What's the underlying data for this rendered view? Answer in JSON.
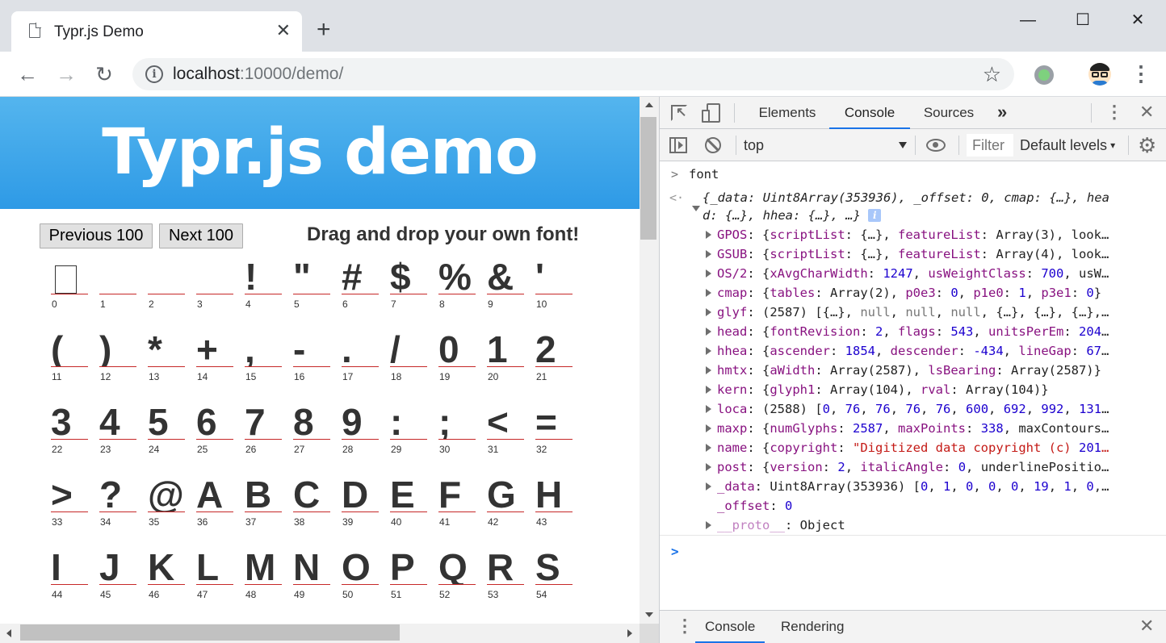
{
  "browser": {
    "tab_title": "Typr.js Demo",
    "tab_close": "✕",
    "new_tab": "+",
    "window_controls": {
      "minimize": "—",
      "maximize": "☐",
      "close": "✕"
    },
    "nav": {
      "back": "←",
      "forward": "→",
      "reload": "↻"
    },
    "url_host": "localhost",
    "url_path": ":10000/demo/",
    "info_symbol": "i",
    "bookmark": "☆",
    "menu": "⋮"
  },
  "page": {
    "title": "Typr.js demo",
    "prev_button": "Previous 100",
    "next_button": "Next 100",
    "drop_hint": "Drag and drop your own font!",
    "glyph_rule_color": "#c62828",
    "banner_color": "#3aa4ea",
    "glyphs": [
      {
        "char": "",
        "index": "0"
      },
      {
        "char": "",
        "index": "1"
      },
      {
        "char": "",
        "index": "2"
      },
      {
        "char": "",
        "index": "3"
      },
      {
        "char": "!",
        "index": "4"
      },
      {
        "char": "\"",
        "index": "5"
      },
      {
        "char": "#",
        "index": "6"
      },
      {
        "char": "$",
        "index": "7"
      },
      {
        "char": "%",
        "index": "8"
      },
      {
        "char": "&",
        "index": "9"
      },
      {
        "char": "'",
        "index": "10"
      },
      {
        "char": "(",
        "index": "11"
      },
      {
        "char": ")",
        "index": "12"
      },
      {
        "char": "*",
        "index": "13"
      },
      {
        "char": "+",
        "index": "14"
      },
      {
        "char": ",",
        "index": "15"
      },
      {
        "char": "-",
        "index": "16"
      },
      {
        "char": ".",
        "index": "17"
      },
      {
        "char": "/",
        "index": "18"
      },
      {
        "char": "0",
        "index": "19"
      },
      {
        "char": "1",
        "index": "20"
      },
      {
        "char": "2",
        "index": "21"
      },
      {
        "char": "3",
        "index": "22"
      },
      {
        "char": "4",
        "index": "23"
      },
      {
        "char": "5",
        "index": "24"
      },
      {
        "char": "6",
        "index": "25"
      },
      {
        "char": "7",
        "index": "26"
      },
      {
        "char": "8",
        "index": "27"
      },
      {
        "char": "9",
        "index": "28"
      },
      {
        "char": ":",
        "index": "29"
      },
      {
        "char": ";",
        "index": "30"
      },
      {
        "char": "<",
        "index": "31"
      },
      {
        "char": "=",
        "index": "32"
      },
      {
        "char": ">",
        "index": "33"
      },
      {
        "char": "?",
        "index": "34"
      },
      {
        "char": "@",
        "index": "35"
      },
      {
        "char": "A",
        "index": "36"
      },
      {
        "char": "B",
        "index": "37"
      },
      {
        "char": "C",
        "index": "38"
      },
      {
        "char": "D",
        "index": "39"
      },
      {
        "char": "E",
        "index": "40"
      },
      {
        "char": "F",
        "index": "41"
      },
      {
        "char": "G",
        "index": "42"
      },
      {
        "char": "H",
        "index": "43"
      },
      {
        "char": "I",
        "index": "44"
      },
      {
        "char": "J",
        "index": "45"
      },
      {
        "char": "K",
        "index": "46"
      },
      {
        "char": "L",
        "index": "47"
      },
      {
        "char": "M",
        "index": "48"
      },
      {
        "char": "N",
        "index": "49"
      },
      {
        "char": "O",
        "index": "50"
      },
      {
        "char": "P",
        "index": "51"
      },
      {
        "char": "Q",
        "index": "52"
      },
      {
        "char": "R",
        "index": "53"
      },
      {
        "char": "S",
        "index": "54"
      }
    ]
  },
  "devtools": {
    "tabs": [
      "Elements",
      "Console",
      "Sources"
    ],
    "active_tab": "Console",
    "more_tabs": "»",
    "context": "top",
    "filter_placeholder": "Filter",
    "levels": "Default levels",
    "accent_color": "#1a73e8",
    "console": {
      "input": "font",
      "summary_1": "{_data: Uint8Array(353936), _offset: 0, cmap: {…}, hea",
      "summary_2": "d: {…}, hhea: {…}, …}",
      "info_badge": "i",
      "props": [
        {
          "key": "GPOS",
          "value": "{scriptList: {…}, featureList: Array(3), look…",
          "expandable": true
        },
        {
          "key": "GSUB",
          "value": "{scriptList: {…}, featureList: Array(4), look…",
          "expandable": true
        },
        {
          "key": "OS/2",
          "value": "{xAvgCharWidth: 1247, usWeightClass: 700, usW…",
          "expandable": true
        },
        {
          "key": "cmap",
          "value": "{tables: Array(2), p0e3: 0, p1e0: 1, p3e1: 0}",
          "expandable": true
        },
        {
          "key": "glyf",
          "value": "(2587) [{…}, null, null, null, {…}, {…}, {…},…",
          "expandable": true
        },
        {
          "key": "head",
          "value": "{fontRevision: 2, flags: 543, unitsPerEm: 204…",
          "expandable": true
        },
        {
          "key": "hhea",
          "value": "{ascender: 1854, descender: -434, lineGap: 67…",
          "expandable": true
        },
        {
          "key": "hmtx",
          "value": "{aWidth: Array(2587), lsBearing: Array(2587)}",
          "expandable": true
        },
        {
          "key": "kern",
          "value": "{glyph1: Array(104), rval: Array(104)}",
          "expandable": true
        },
        {
          "key": "loca",
          "value": "(2588) [0, 76, 76, 76, 76, 600, 692, 992, 131…",
          "expandable": true
        },
        {
          "key": "maxp",
          "value": "{numGlyphs: 2587, maxPoints: 338, maxContours…",
          "expandable": true
        },
        {
          "key": "name",
          "value": "{copyright: \"Digitized data copyright (c) 201…",
          "expandable": true
        },
        {
          "key": "post",
          "value": "{version: 2, italicAngle: 0, underlinePositio…",
          "expandable": true
        },
        {
          "key": "_data",
          "value": "Uint8Array(353936) [0, 1, 0, 0, 0, 19, 1, 0,…",
          "expandable": true
        },
        {
          "key": "_offset",
          "value": "0",
          "expandable": false
        },
        {
          "key": "__proto__",
          "value": "Object",
          "expandable": true
        }
      ]
    },
    "drawer_tabs": [
      "Console",
      "Rendering"
    ],
    "close": "✕",
    "kebab": "⋮",
    "gear": "⚙"
  }
}
